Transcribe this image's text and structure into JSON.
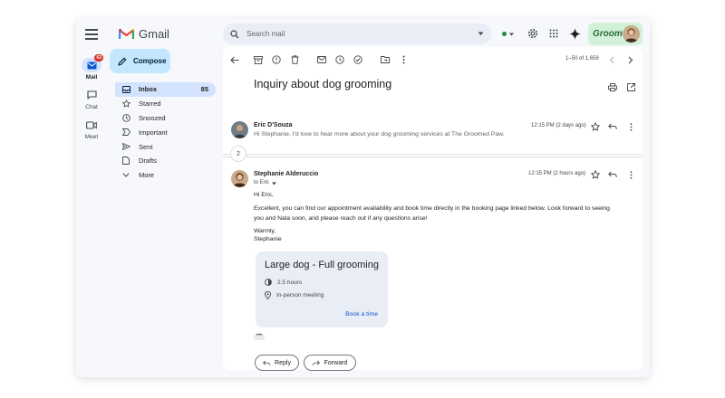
{
  "app": {
    "name": "Gmail"
  },
  "rail": {
    "items": [
      {
        "label": "Mail",
        "badge": "63",
        "icon": "mail-icon",
        "active": true
      },
      {
        "label": "Chat",
        "icon": "chat-icon"
      },
      {
        "label": "Meet",
        "icon": "video-icon"
      }
    ]
  },
  "search": {
    "placeholder": "Search mail"
  },
  "status": {
    "color": "#1e8e3e"
  },
  "brand": {
    "label": "Groom"
  },
  "compose": {
    "label": "Compose"
  },
  "nav": {
    "items": [
      {
        "label": "Inbox",
        "count": "85",
        "icon": "inbox-icon",
        "active": true
      },
      {
        "label": "Starred",
        "icon": "star-icon"
      },
      {
        "label": "Snoozed",
        "icon": "clock-icon"
      },
      {
        "label": "Important",
        "icon": "important-icon"
      },
      {
        "label": "Sent",
        "icon": "send-icon"
      },
      {
        "label": "Drafts",
        "icon": "draft-icon"
      },
      {
        "label": "More",
        "icon": "chevron-down-icon"
      }
    ]
  },
  "toolbar": {
    "pager": "1–50 of 1,659",
    "icons": [
      "back-icon",
      "archive-icon",
      "report-spam-icon",
      "delete-icon",
      "mark-unread-icon",
      "snooze-icon",
      "add-task-icon",
      "move-to-icon",
      "more-vert-icon"
    ]
  },
  "thread": {
    "subject": "Inquiry about dog grooming",
    "collapsed_count": "2",
    "messages": [
      {
        "sender": "Eric D'Souza",
        "time": "12:15 PM (2 days ago)",
        "snippet": "Hi Stephanie, I'd love to hear more about your dog grooming services at The Groomed Paw."
      },
      {
        "sender": "Stephanie Alderuccio",
        "to": "to Eric",
        "time": "12:15 PM (2 hours ago)",
        "greeting": "Hi Eric,",
        "body_line1": "Excellent, you can find our appointment availability and book time directly in the booking page linked below. Look forward to seeing",
        "body_line2": "you and Nala soon, and please reach out if any questions arise!",
        "signoff": "Warmly,",
        "signature": "Stephanie"
      }
    ]
  },
  "card": {
    "title": "Large dog - Full grooming",
    "duration": "2.5 hours",
    "location": "In-person meeting",
    "link": "Book a time"
  },
  "actions": {
    "reply": "Reply",
    "forward": "Forward"
  },
  "colors": {
    "accent": "#0b57d0",
    "compose_bg": "#c2e7ff",
    "active_nav": "#d3e3fd",
    "brand_bg": "#d1f2d9"
  }
}
